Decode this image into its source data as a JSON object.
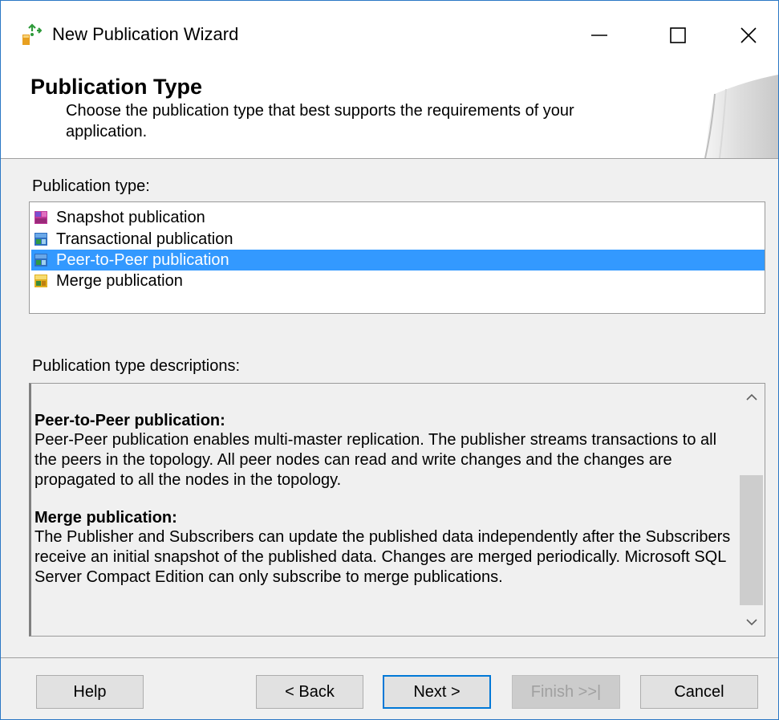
{
  "window": {
    "title": "New Publication Wizard",
    "controls": {
      "minimize": "minimize-icon",
      "maximize": "maximize-icon",
      "close": "close-icon"
    }
  },
  "header": {
    "title": "Publication Type",
    "description": "Choose the publication type that best supports the requirements of your application."
  },
  "publication_types": {
    "label": "Publication type:",
    "items": [
      {
        "label": "Snapshot publication",
        "icon": "snapshot-publication-icon",
        "selected": false
      },
      {
        "label": "Transactional publication",
        "icon": "transactional-publication-icon",
        "selected": false
      },
      {
        "label": "Peer-to-Peer publication",
        "icon": "peer-to-peer-publication-icon",
        "selected": true
      },
      {
        "label": "Merge publication",
        "icon": "merge-publication-icon",
        "selected": false
      }
    ]
  },
  "descriptions": {
    "label": "Publication type descriptions:",
    "sections": [
      {
        "heading": "Peer-to-Peer publication:",
        "body": "Peer-Peer publication enables multi-master replication. The publisher streams transactions to all the peers in the topology. All peer nodes can read and write changes and the changes are propagated to all the nodes in the topology."
      },
      {
        "heading": "Merge publication:",
        "body": "The Publisher and Subscribers can update the published data independently after the Subscribers receive an initial snapshot of the published data. Changes are merged periodically. Microsoft SQL Server Compact Edition can only subscribe to merge publications."
      }
    ]
  },
  "buttons": {
    "help": "Help",
    "back": "< Back",
    "next": "Next >",
    "finish": "Finish >>|",
    "cancel": "Cancel"
  },
  "colors": {
    "selection": "#3399ff",
    "window_border": "#2b78c5",
    "default_button_border": "#0078d7",
    "dialog_background": "#f0f0f0"
  }
}
